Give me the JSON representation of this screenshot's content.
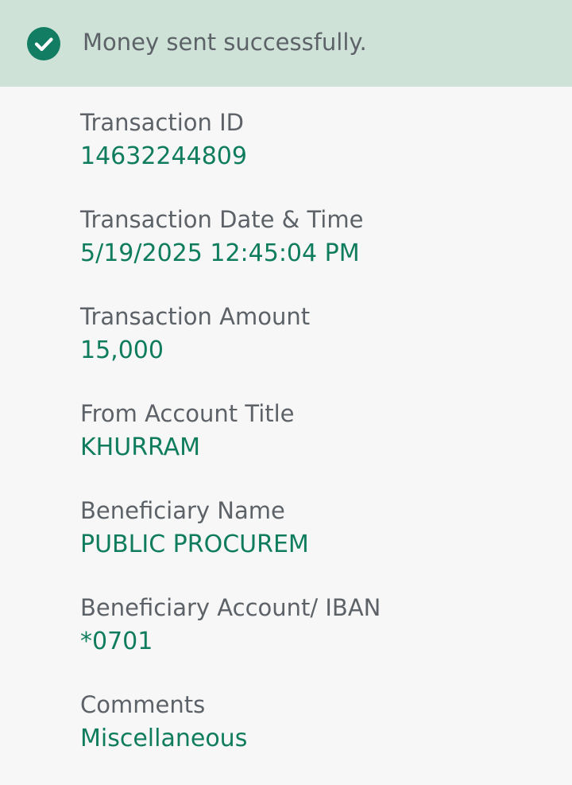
{
  "banner": {
    "message": "Money sent successfully.",
    "icon": "check-circle-icon",
    "background_color": "#cfe2d8",
    "icon_color": "#127d62"
  },
  "details": [
    {
      "label": "Transaction ID",
      "value": "14632244809"
    },
    {
      "label": "Transaction Date & Time",
      "value": "5/19/2025 12:45:04 PM"
    },
    {
      "label": "Transaction Amount",
      "value": "15,000"
    },
    {
      "label": "From Account Title",
      "value": "KHURRAM"
    },
    {
      "label": "Beneficiary Name",
      "value": "PUBLIC PROCUREM"
    },
    {
      "label": "Beneficiary Account/ IBAN",
      "value": "*0701"
    },
    {
      "label": "Comments",
      "value": "Miscellaneous"
    }
  ],
  "colors": {
    "label": "#5c6267",
    "value": "#0f7d5d",
    "page_background": "#f7f7f7"
  }
}
